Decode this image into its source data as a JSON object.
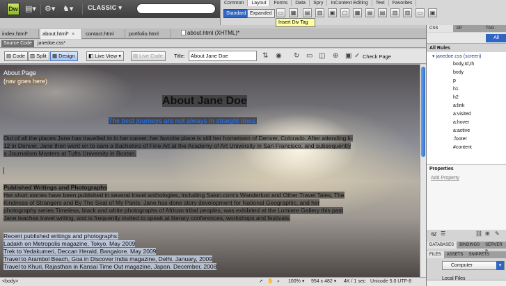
{
  "app": {
    "logo": "Dw",
    "workspace": "CLASSIC"
  },
  "insert": {
    "tabs": [
      "Common",
      "Layout",
      "Forms",
      "Data",
      "Spry",
      "InContext Editing",
      "Text",
      "Favorites"
    ],
    "active_tab": "Layout",
    "mode_standard": "Standard",
    "mode_expanded": "Expanded",
    "tooltip": "Insert Div Tag"
  },
  "doc_tabs": [
    {
      "label": "index.html*"
    },
    {
      "label": "about.html*"
    },
    {
      "label": "contact.html"
    },
    {
      "label": "portfolio.html"
    }
  ],
  "doc_path": "about.html (XHTML)*",
  "related": {
    "source_code": "Source Code",
    "file": "janedoe.css*"
  },
  "toolbar": {
    "code": "Code",
    "split": "Split",
    "design": "Design",
    "live_view": "Live View",
    "live_code": "Live Code",
    "title_label": "Title:",
    "title_value": "About Jane Doe",
    "check_page": "Check Page"
  },
  "page": {
    "about_page": "About Page",
    "nav": "(nav goes here)",
    "heading": "About Jane Doe",
    "tagline": "The best journeys are not always in straight lines.",
    "intro": [
      "Out of all the places Jane has travelled to in her career, her favorite place is still her hometown of Denver, Colorado. After attending k-",
      "12 in Denver, Jane then went on to earn a Bachelors of Fine Art at the Academy of Art University in San Francisco, and subsequently",
      "a Journalism Masters at Tufts University in Boston."
    ],
    "pub_heading": "Published Writings and Photographs",
    "pub_text": [
      "Her short stories have been published in several travel anthologies, including Salon.com's Wanderlust and Other Travel Tales, The",
      "Kindness of Strangers and By The Seat of My Pants. Jane has done story development for National Geographic, and her",
      "photography series Timeless, black and white photographs of African tribal peoples, was exhibited at the Lumiere Gallery this past",
      "Jane teaches travel writing, and is frequently invited to speak at literary conferences, workshops and festivals."
    ],
    "recent_heading": "Recent published writings and photographs:",
    "recent_items": [
      "Ladakh on Metropolis magazine, Tokyo. May 2009",
      "Trek to Yedakumeri, Deccan Herald, Bangalore. May 2009",
      "Travel to Arambol Beach, Goa in Discover India magazine, Delhi. January, 2009",
      "Travel to Khuri, Rajasthan in Kansai Time Out magazine, Japan. December, 2008"
    ]
  },
  "status": {
    "tag": "<body>",
    "zoom": "100%",
    "size": "954 x 482",
    "download": "4K / 1 sec",
    "encoding": "Unicode 5.0 UTF-8"
  },
  "css_panel": {
    "tabs": [
      "CSS STYLES",
      "AP ELEMENTS",
      "TAG INSPE"
    ],
    "all": "All",
    "all_rules": "All Rules",
    "stylesheet": "janedoe.css (screen)",
    "rules": [
      "body,td,th",
      "body",
      "p",
      "h1",
      "h2",
      "a:link",
      "a:visited",
      "a:hover",
      "a:active",
      ".footer",
      "#content"
    ],
    "properties": "Properties",
    "add_property": "Add Property"
  },
  "db_panel": {
    "tabs": [
      "DATABASES",
      "BINDINGS",
      "SERVER B"
    ]
  },
  "files_panel": {
    "tabs": [
      "FILES",
      "ASSETS",
      "SNIPPETS"
    ],
    "site": "Computer",
    "local_files": "Local Files"
  }
}
